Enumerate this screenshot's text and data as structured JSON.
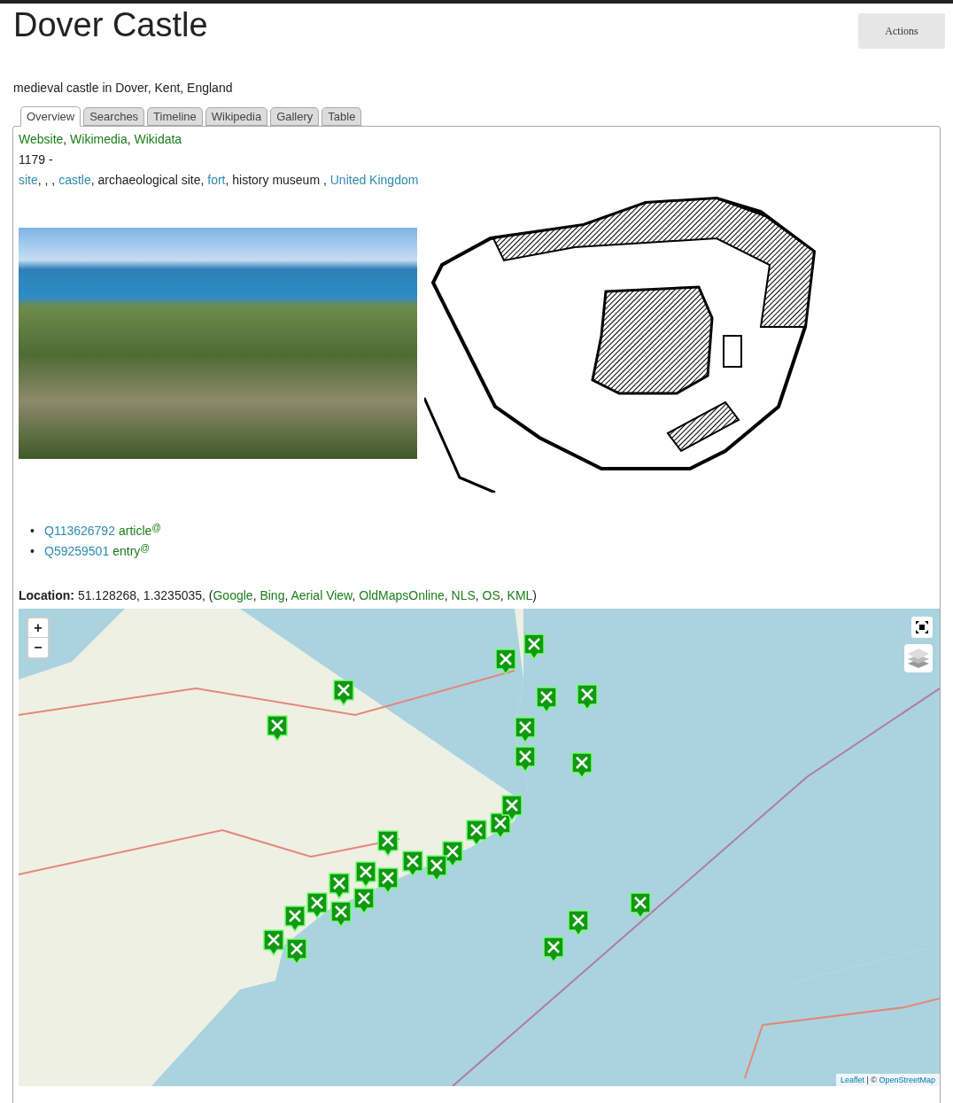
{
  "title": "Dover Castle",
  "actions_button": "Actions",
  "description": "medieval castle in Dover, Kent, England",
  "tabs": [
    {
      "label": "Overview",
      "selected": true
    },
    {
      "label": "Searches",
      "selected": false
    },
    {
      "label": "Timeline",
      "selected": false
    },
    {
      "label": "Wikipedia",
      "selected": false
    },
    {
      "label": "Gallery",
      "selected": false
    },
    {
      "label": "Table",
      "selected": false
    }
  ],
  "external_links": [
    {
      "text": "Website",
      "kind": "link"
    },
    {
      "text": ", ",
      "kind": "plain"
    },
    {
      "text": "Wikimedia",
      "kind": "link"
    },
    {
      "text": ", ",
      "kind": "plain"
    },
    {
      "text": "Wikidata",
      "kind": "link"
    }
  ],
  "dates": "1179 -",
  "categories": [
    {
      "text": "site",
      "kind": "link"
    },
    {
      "text": ", , , ",
      "kind": "plain"
    },
    {
      "text": "castle",
      "kind": "link"
    },
    {
      "text": ", archaeological site, ",
      "kind": "plain"
    },
    {
      "text": "fort",
      "kind": "link"
    },
    {
      "text": ", history museum , ",
      "kind": "plain"
    },
    {
      "text": "United Kingdom",
      "kind": "link"
    }
  ],
  "references": [
    {
      "bullet": "•",
      "id": "Q113626792",
      "label": "article$^{@}$"
    },
    {
      "bullet": "•",
      "id": "Q59259501",
      "label": "entry$^{@}$"
    }
  ],
  "location": {
    "label": "Location:",
    "coordinates": "51.128268, 1.3235035, (",
    "links": [
      {
        "text": "Google",
        "kind": "link"
      },
      {
        "text": ", ",
        "kind": "plain"
      },
      {
        "text": "Bing",
        "kind": "link"
      },
      {
        "text": ", ",
        "kind": "plain"
      },
      {
        "text": "Aerial View",
        "kind": "link"
      },
      {
        "text": ", ",
        "kind": "plain"
      },
      {
        "text": "OldMapsOnline",
        "kind": "link"
      },
      {
        "text": ", ",
        "kind": "plain"
      },
      {
        "text": "NLS",
        "kind": "link"
      },
      {
        "text": ", ",
        "kind": "plain"
      },
      {
        "text": "OS",
        "kind": "link"
      },
      {
        "text": ", ",
        "kind": "plain"
      },
      {
        "text": "KML",
        "kind": "link"
      }
    ],
    "close": ")"
  },
  "map": {
    "zoom_in": "+",
    "zoom_out": "−",
    "attribution_link": "Leaflet",
    "attribution_sep": " | © ",
    "attribution_osm": "OpenStreetMap"
  }
}
